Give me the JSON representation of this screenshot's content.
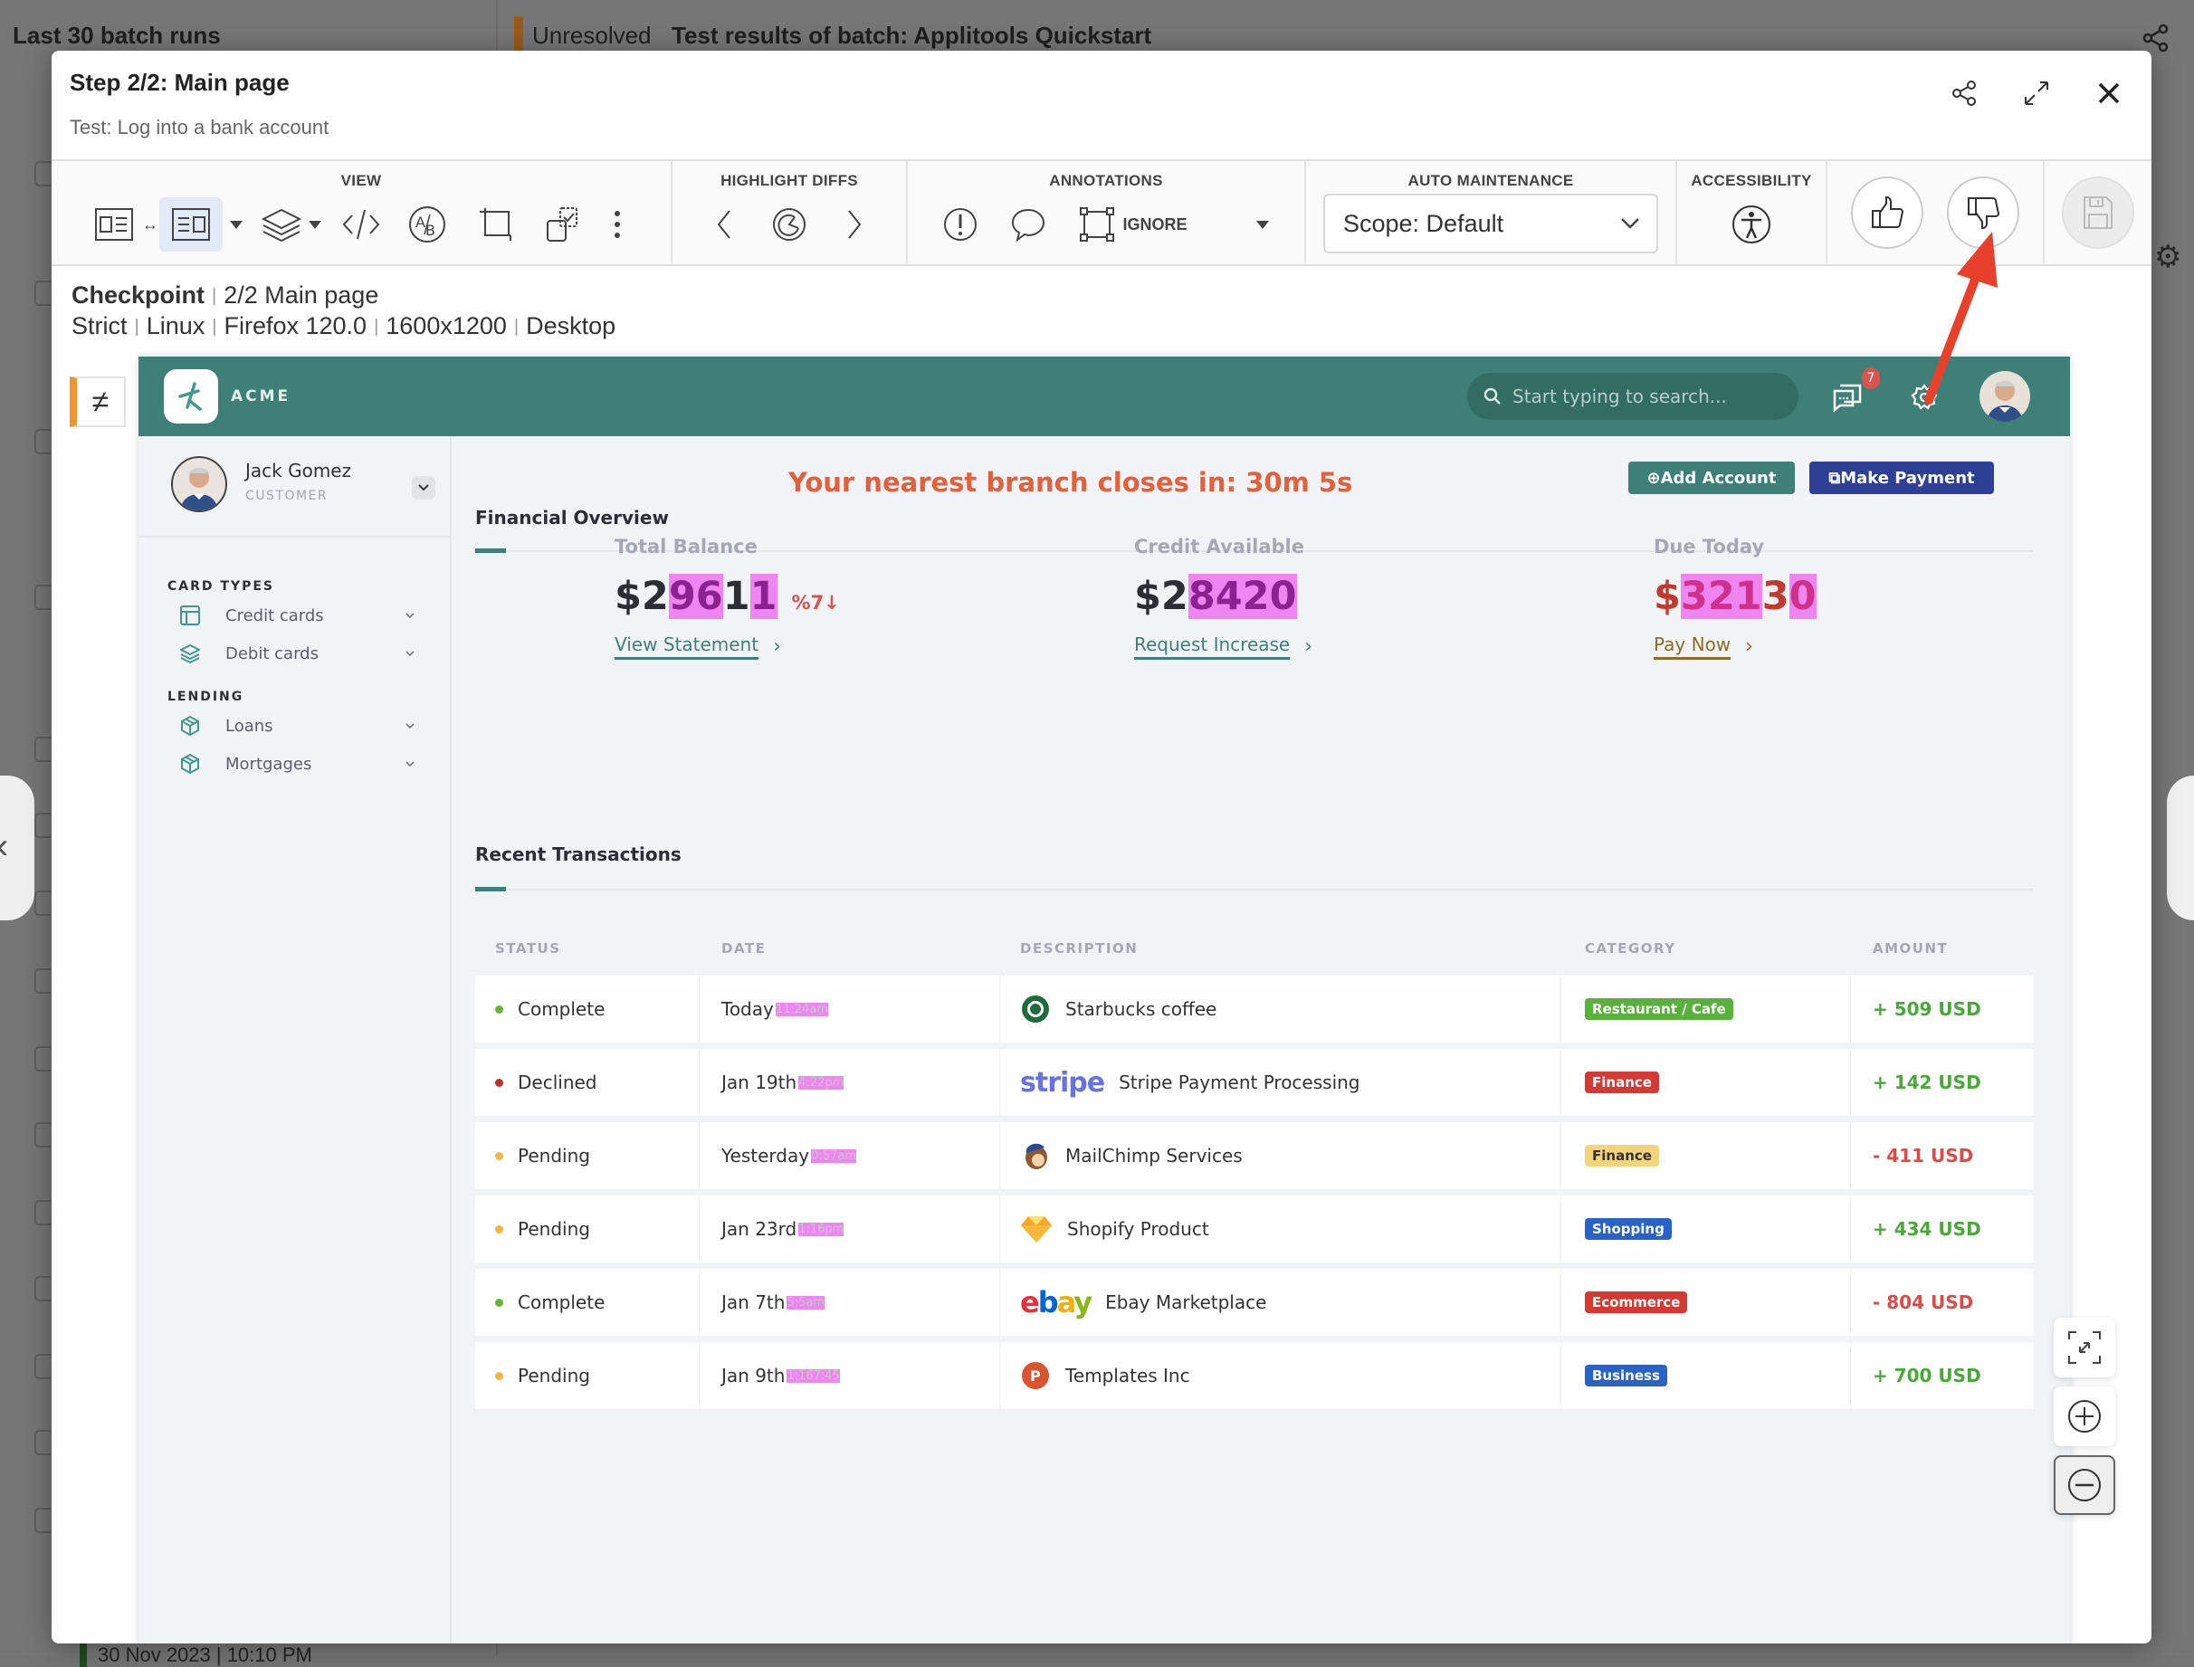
{
  "background": {
    "left_title": "Last 30 batch runs",
    "status": "Unresolved",
    "batch_title": "Test results of batch:  Applitools Quickstart",
    "bottom_row_text": "30 Nov 2023 | 10:10 PM"
  },
  "modal": {
    "title": "Step 2/2:  Main page",
    "subtitle": "Test: Log into a bank account",
    "header_icons": [
      "share-icon",
      "expand-icon",
      "close-icon"
    ]
  },
  "toolbar": {
    "view_label": "VIEW",
    "highlight_label": "HIGHLIGHT DIFFS",
    "annotations_label": "ANNOTATIONS",
    "ignore_label": "IGNORE",
    "auto_maintenance_label": "AUTO MAINTENANCE",
    "scope_value": "Scope: Default",
    "accessibility_label": "ACCESSIBILITY"
  },
  "checkpoint": {
    "label": "Checkpoint",
    "name": "2/2 Main page",
    "match_level": "Strict",
    "os": "Linux",
    "browser": "Firefox 120.0",
    "viewport": "1600x1200",
    "device": "Desktop"
  },
  "diff_toggle": "≠",
  "app": {
    "brand": "ACME",
    "search_placeholder": "Start typing to search...",
    "notification_count": "7",
    "user": {
      "name": "Jack Gomez",
      "role": "CUSTOMER"
    },
    "sidebar": {
      "sections": [
        {
          "title": "CARD TYPES",
          "items": [
            {
              "label": "Credit cards",
              "icon": "credit-card-icon"
            },
            {
              "label": "Debit cards",
              "icon": "layers-icon"
            }
          ]
        },
        {
          "title": "LENDING",
          "items": [
            {
              "label": "Loans",
              "icon": "box-icon"
            },
            {
              "label": "Mortgages",
              "icon": "box-icon"
            }
          ]
        }
      ]
    },
    "branch_message": "Your nearest branch closes in: 30m 5s",
    "add_account": "⊕Add Account",
    "make_payment": "⧉Make Payment",
    "financial_overview": "Financial Overview",
    "stats": [
      {
        "label": "Total Balance",
        "value": "$29611",
        "delta": "%7↓",
        "link": "View Statement",
        "color": "#2b2e33",
        "link_color": "#3e8077"
      },
      {
        "label": "Credit Available",
        "value": "$28420",
        "delta": "",
        "link": "Request Increase",
        "color": "#2b2e33",
        "link_color": "#3e8077"
      },
      {
        "label": "Due Today",
        "value": "$32130",
        "delta": "",
        "link": "Pay Now",
        "color": "#c23a2f",
        "link_color": "#8d6b23"
      }
    ],
    "recent_transactions": "Recent Transactions",
    "table": {
      "headers": [
        "STATUS",
        "DATE",
        "DESCRIPTION",
        "CATEGORY",
        "AMOUNT"
      ],
      "rows": [
        {
          "status": "Complete",
          "status_color": "#65b636",
          "date": "Today",
          "time": "11:24am",
          "logo": "starbucks-logo-icon",
          "description": "Starbucks coffee",
          "category": "Restaurant / Cafe",
          "category_color": "#57b13a",
          "category_text": "#ffffff",
          "amount": "+ 509 USD",
          "amount_color": "#4aa83a"
        },
        {
          "status": "Declined",
          "status_color": "#c0302b",
          "date": "Jan 19th",
          "time": "4:22pm",
          "logo": "stripe-logo-icon",
          "description": "Stripe Payment Processing",
          "category": "Finance",
          "category_color": "#d23a33",
          "category_text": "#ffffff",
          "amount": "+ 142 USD",
          "amount_color": "#4aa83a"
        },
        {
          "status": "Pending",
          "status_color": "#f0b542",
          "date": "Yesterday",
          "time": "0:57am",
          "logo": "mailchimp-logo-icon",
          "description": "MailChimp Services",
          "category": "Finance",
          "category_color": "#f3d47b",
          "category_text": "#333333",
          "amount": "- 411 USD",
          "amount_color": "#df4a47"
        },
        {
          "status": "Pending",
          "status_color": "#f0b542",
          "date": "Jan 23rd",
          "time": "1:16pm",
          "logo": "sketch-logo-icon",
          "description": "Shopify Product",
          "category": "Shopping",
          "category_color": "#2a63c8",
          "category_text": "#ffffff",
          "amount": "+ 434 USD",
          "amount_color": "#4aa83a"
        },
        {
          "status": "Complete",
          "status_color": "#65b636",
          "date": "Jan 7th",
          "time": "5:5am",
          "logo": "ebay-logo-icon",
          "description": "Ebay Marketplace",
          "category": "Ecommerce",
          "category_color": "#d23a33",
          "category_text": "#ffffff",
          "amount": "- 804 USD",
          "amount_color": "#df4a47"
        },
        {
          "status": "Pending",
          "status_color": "#f0b542",
          "date": "Jan 9th",
          "time": "1:167:45",
          "logo": "producthunt-logo-icon",
          "description": "Templates Inc",
          "category": "Business",
          "category_color": "#2a63c8",
          "category_text": "#ffffff",
          "amount": "+ 700 USD",
          "amount_color": "#4aa83a"
        }
      ]
    }
  },
  "colors": {
    "teal": "#3e8077",
    "navy": "#2e3f94",
    "diff_highlight": "#ef85f0",
    "annotation_arrow": "#e8402a",
    "unresolved": "#f0962f"
  }
}
